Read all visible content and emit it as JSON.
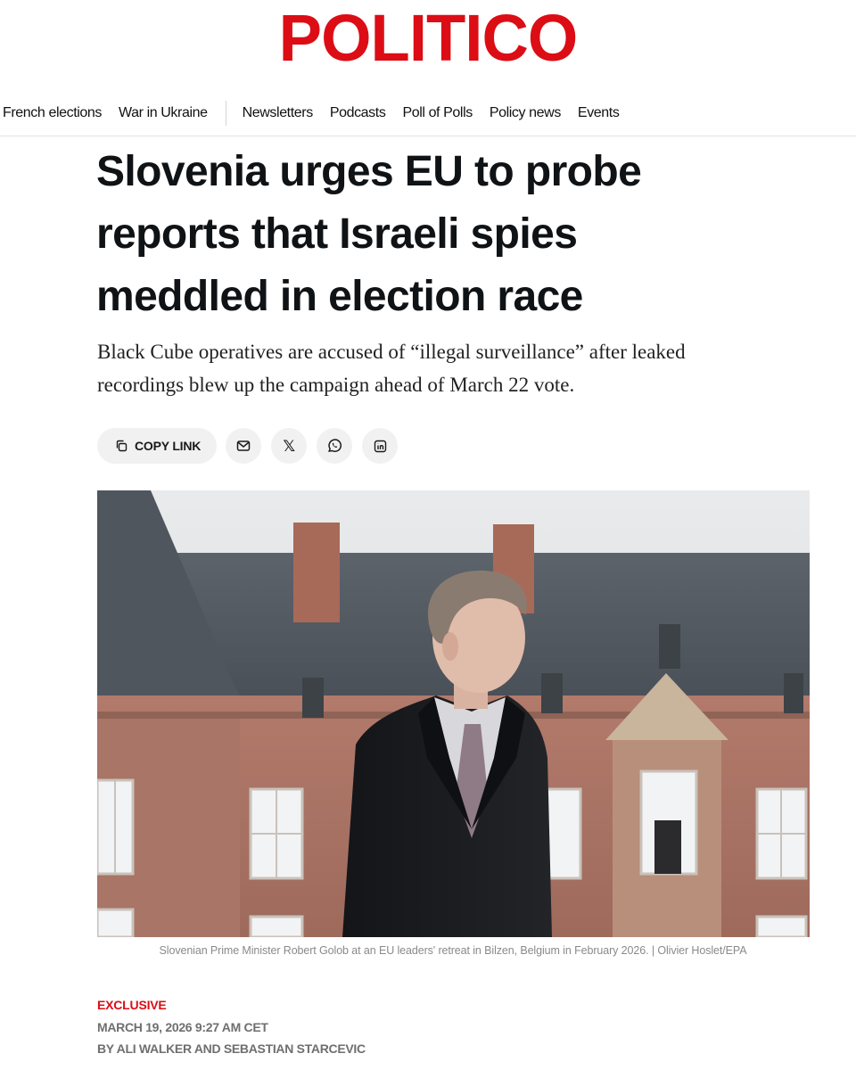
{
  "site": {
    "logo": "POLITICO",
    "brand_color": "#dc0d15"
  },
  "nav": {
    "items": [
      {
        "label": "French elections"
      },
      {
        "label": "War in Ukraine"
      },
      {
        "label": "Newsletters"
      },
      {
        "label": "Podcasts"
      },
      {
        "label": "Poll of Polls"
      },
      {
        "label": "Policy news"
      },
      {
        "label": "Events"
      }
    ]
  },
  "article": {
    "headline_lines": [
      "Slovenia urges EU to probe",
      "reports that Israeli spies",
      "meddled in election race"
    ],
    "dek_lines": [
      "Black Cube operatives are accused of “illegal surveillance” after leaked",
      "recordings blew up the campaign ahead of March 22 vote."
    ],
    "share": {
      "copy_link_label": "COPY LINK",
      "icons": [
        "link-icon",
        "email-icon",
        "x-icon",
        "whatsapp-icon",
        "linkedin-icon"
      ]
    },
    "image_caption": "Slovenian Prime Minister Robert Golob at an EU leaders' retreat in Bilzen, Belgium in February 2026. | Olivier Hoslet/EPA",
    "kicker": "EXCLUSIVE",
    "date": "MARCH 19, 2026 9:27 AM CET",
    "byline": "BY ALI WALKER AND SEBASTIAN STARCEVIC"
  }
}
